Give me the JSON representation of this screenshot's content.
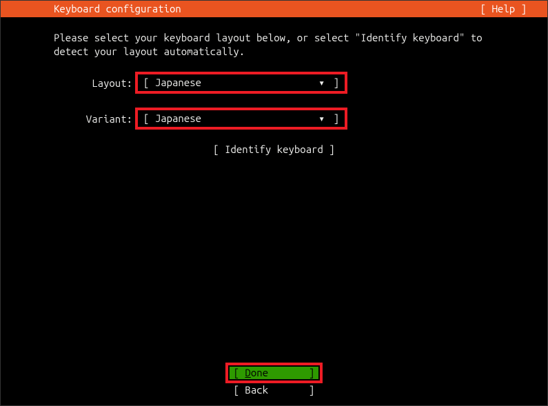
{
  "header": {
    "title": "Keyboard configuration",
    "help_label": "[ Help ]"
  },
  "instruction": "Please select your keyboard layout below, or select \"Identify keyboard\" to\ndetect your layout automatically.",
  "fields": {
    "layout": {
      "label": "Layout:",
      "value": "Japanese"
    },
    "variant": {
      "label": "Variant:",
      "value": "Japanese"
    }
  },
  "identify_button": "[ Identify keyboard ]",
  "footer": {
    "done_first": "D",
    "done_rest": "one",
    "back": "Back"
  }
}
